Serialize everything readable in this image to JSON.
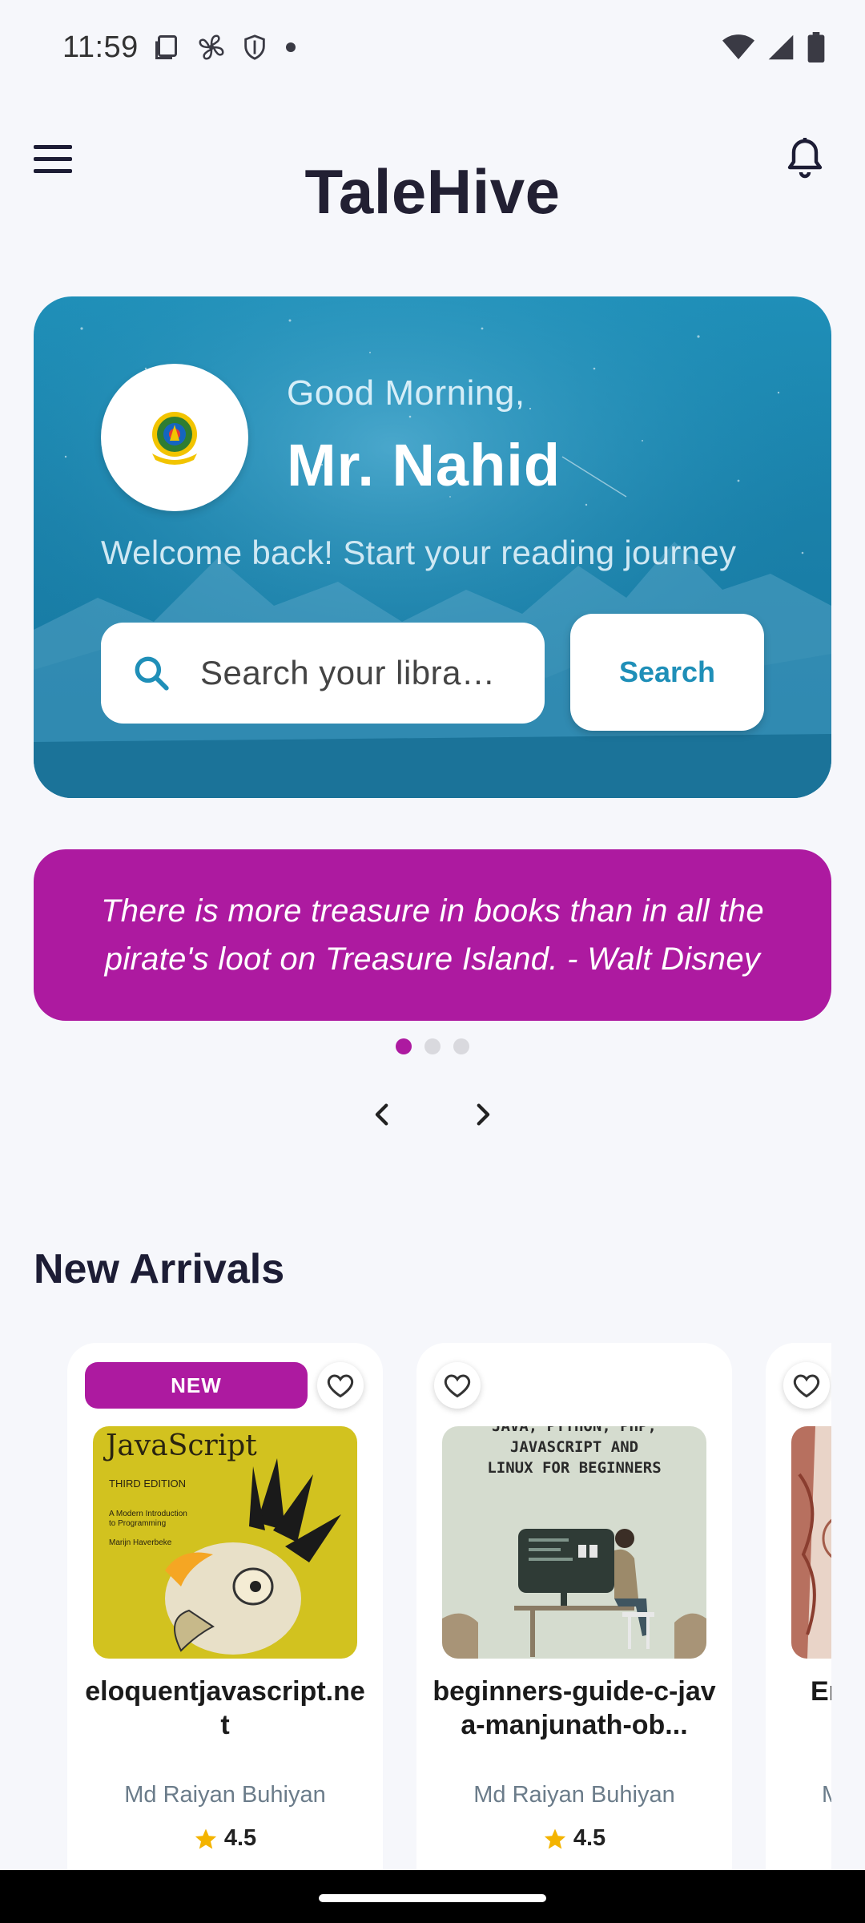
{
  "status_bar": {
    "time": "11:59"
  },
  "app_bar": {
    "title": "TaleHive"
  },
  "hero": {
    "greeting": "Good Morning,",
    "user_name": "Mr. Nahid",
    "welcome": "Welcome back! Start your reading journey",
    "search_placeholder": "Search your library...",
    "search_button": "Search"
  },
  "quote": {
    "text": "There is more treasure in books than in all the pirate's loot on Treasure Island. - Walt Disney",
    "page_count": 3,
    "active_page": 1
  },
  "new_arrivals": {
    "title": "New Arrivals",
    "badge": "NEW",
    "books": [
      {
        "title": "eloquentjavascript.net",
        "author": "Md Raiyan Buhiyan",
        "rating": "4.5",
        "cover_title": "JavaScript",
        "cover_edition": "THIRD EDITION",
        "cover_sub1": "A Modern Introduction",
        "cover_sub2": "to Programming",
        "cover_author": "Marijn Haverbeke"
      },
      {
        "title": "beginners-guide-c-java-manjunath-ob...",
        "author": "Md Raiyan Buhiyan",
        "rating": "4.5",
        "cover_line1": "JAVA, PYTHON, PHP,",
        "cover_line2": "JAVASCRIPT AND",
        "cover_line3": "LINUX FOR BEGINNERS"
      },
      {
        "title": "En o",
        "author": "M",
        "rating": ""
      }
    ]
  },
  "colors": {
    "accent": "#ad1aa0",
    "hero_blue": "#1f8fb8",
    "background": "#f6f7fb"
  }
}
